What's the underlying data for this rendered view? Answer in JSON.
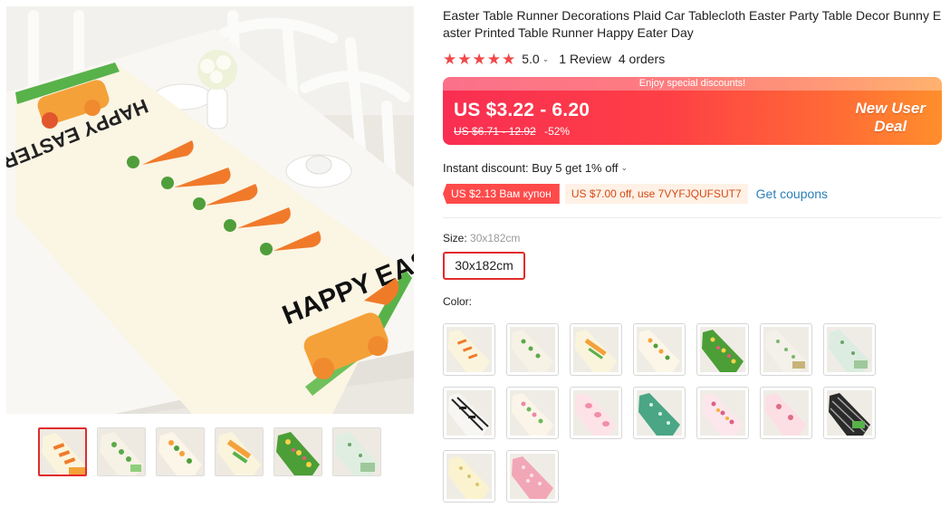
{
  "product": {
    "title": "Easter Table Runner Decorations Plaid Car Tablecloth Easter Party Table Decor Bunny Easter Printed Table Runner Happy Eater Day",
    "image_text_top": "HAPPY EASTER!",
    "image_text_bottom": "HAPPY EASTER!"
  },
  "rating": {
    "stars": 5,
    "score": "5.0",
    "reviews": "1 Review",
    "orders": "4 orders"
  },
  "price": {
    "banner": "Enjoy special discounts!",
    "current": "US $3.22 - 6.20",
    "original": "US $6.71 - 12.92",
    "discount": "-52%",
    "new_user_line1": "New User",
    "new_user_line2": "Deal",
    "gradient_start": "#f92e52",
    "gradient_end": "#ff8e2c"
  },
  "instant_discount": "Instant discount: Buy 5 get 1% off",
  "coupons": {
    "red_coupon": "US $2.13 Вам купон",
    "code_coupon": "US $7.00 off, use 7VYFJQUFSUT7",
    "get_coupons": "Get coupons"
  },
  "size": {
    "label": "Size:",
    "selected": "30x182cm",
    "options": [
      "30x182cm"
    ]
  },
  "color": {
    "label": "Color:"
  },
  "colors": {
    "accent": "#e12b2b",
    "link": "#2c7fb8"
  }
}
